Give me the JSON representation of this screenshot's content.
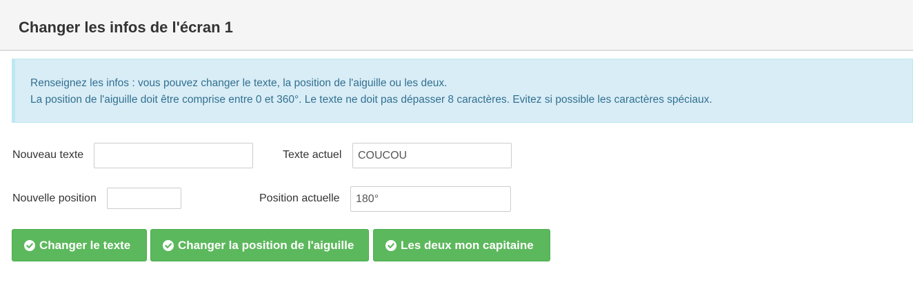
{
  "header": {
    "title": "Changer les infos de l'écran 1"
  },
  "alert": {
    "line1": "Renseignez les infos : vous pouvez changer le texte, la position de l'aiguille ou les deux.",
    "line2": "La position de l'aiguille doit être comprise entre 0 et 360°. Le texte ne doit pas dépasser 8 caractères. Evitez si possible les caractères spéciaux."
  },
  "form": {
    "new_text_label": "Nouveau texte",
    "new_text_value": "",
    "current_text_label": "Texte actuel",
    "current_text_value": "COUCOU",
    "new_position_label": "Nouvelle position",
    "new_position_value": "",
    "current_position_label": "Position actuelle",
    "current_position_value": "180°"
  },
  "buttons": {
    "change_text": "Changer le texte",
    "change_position": "Changer la position de l'aiguille",
    "change_both": "Les deux mon capitaine"
  },
  "colors": {
    "success_green": "#5cb85c",
    "info_background": "#d9edf7",
    "info_text": "#31708f"
  },
  "icons": {
    "button_icon": "check-circle-icon"
  }
}
